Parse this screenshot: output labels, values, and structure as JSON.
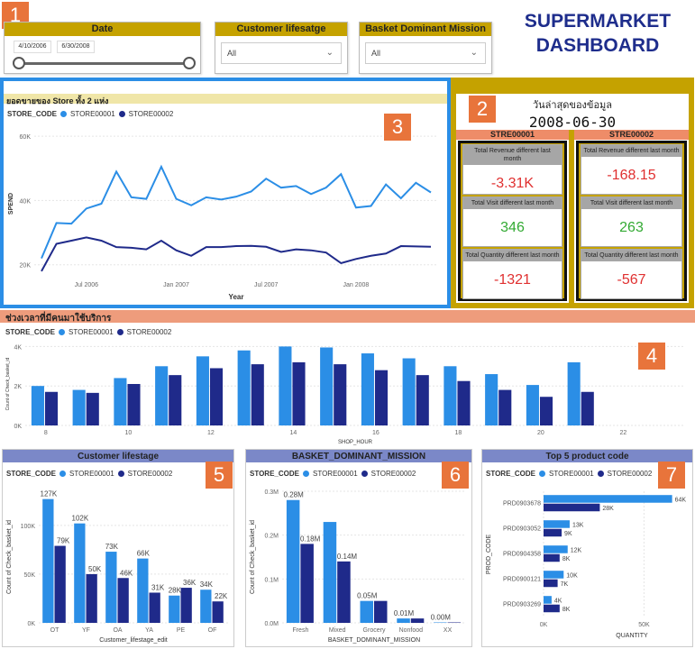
{
  "dashboard_title_line1": "SUPERMARKET",
  "dashboard_title_line2": "DASHBOARD",
  "badges": [
    "1",
    "2",
    "3",
    "4",
    "5",
    "6",
    "7"
  ],
  "colors": {
    "store1": "#2b8ee6",
    "store2": "#1f2a8a",
    "gold": "#c5a200",
    "blue_panel": "#2b8ee6",
    "orange": "#ee8c68",
    "red": "#e03030",
    "green": "#33aa33"
  },
  "date_slicer": {
    "title": "Date",
    "start": "4/10/2006",
    "end": "6/30/2008"
  },
  "lifestage_slicer": {
    "title": "Customer lifesatge",
    "value": "All"
  },
  "mission_slicer": {
    "title": "Basket Dominant Mission",
    "value": "All"
  },
  "latest_date": {
    "label": "วันล่าสุดของข้อมูล",
    "value": "2008-06-30"
  },
  "store_cards": [
    {
      "name": "STRE00001",
      "rev_label": "Total Revenue different last month",
      "rev": "-3.31K",
      "visit_label": "Total Visit different last month",
      "visit": "346",
      "qty_label": "Total Quantity different last month",
      "qty": "-1321"
    },
    {
      "name": "STRE00002",
      "rev_label": "Total Revenue different last month",
      "rev": "-168.15",
      "visit_label": "Total Visit different last month",
      "visit": "263",
      "qty_label": "Total Quantity different last month",
      "qty": "-567"
    }
  ],
  "legend": {
    "title": "STORE_CODE",
    "s1": "STORE00001",
    "s2": "STORE00002"
  },
  "chart_data": [
    {
      "type": "line",
      "title": "ยอดขายของ Store ทั้ง 2 แห่ง",
      "xlabel": "Year",
      "ylabel": "SPEND",
      "ylim": [
        16000,
        62000
      ],
      "yticks": [
        "20K",
        "40K",
        "60K"
      ],
      "xticks": [
        "Jul 2006",
        "Jan 2007",
        "Jul 2007",
        "Jan 2008"
      ],
      "series": [
        {
          "name": "STORE00001",
          "values": [
            22000,
            33000,
            32800,
            37500,
            39000,
            49000,
            41000,
            40500,
            50500,
            40500,
            38500,
            41000,
            40300,
            41200,
            42800,
            46800,
            44000,
            44500,
            42000,
            44000,
            48200,
            37800,
            38300,
            45000,
            40700,
            45500,
            42500
          ]
        },
        {
          "name": "STORE00002",
          "values": [
            18000,
            26500,
            27500,
            28500,
            27500,
            25500,
            25300,
            24800,
            27500,
            24500,
            22800,
            25500,
            25500,
            25800,
            25900,
            25600,
            24000,
            24800,
            24500,
            23800,
            20500,
            21800,
            22800,
            23500,
            25800,
            25700,
            25600
          ]
        }
      ]
    },
    {
      "type": "bar",
      "title": "ช่วงเวลาที่มีคนมาใช้บริการ",
      "xlabel": "SHOP_HOUR",
      "ylabel": "Count of Check_basket_id",
      "ylim": [
        0,
        4200
      ],
      "yticks": [
        "0K",
        "2K",
        "4K"
      ],
      "xticks": [
        "8",
        "10",
        "12",
        "14",
        "16",
        "18",
        "20",
        "22"
      ],
      "categories": [
        "8",
        "9",
        "10",
        "11",
        "12",
        "13",
        "14",
        "15",
        "16",
        "17",
        "18",
        "19",
        "20",
        "21"
      ],
      "series": [
        {
          "name": "STORE00001",
          "values": [
            2000,
            1800,
            2400,
            3000,
            3500,
            3800,
            4000,
            3950,
            3650,
            3400,
            3000,
            2600,
            2050,
            3200
          ]
        },
        {
          "name": "STORE00002",
          "values": [
            1700,
            1650,
            2100,
            2550,
            2900,
            3100,
            3200,
            3100,
            2800,
            2550,
            2250,
            1800,
            1450,
            1700
          ]
        }
      ]
    },
    {
      "type": "bar",
      "title": "Customer lifestage",
      "xlabel": "Customer_lifestage_edit",
      "ylabel": "Count of Check_basket_id",
      "ylim": [
        0,
        135000
      ],
      "yticks": [
        "0K",
        "50K",
        "100K"
      ],
      "categories": [
        "OT",
        "YF",
        "OA",
        "YA",
        "PE",
        "OF"
      ],
      "series": [
        {
          "name": "STORE00001",
          "values": [
            127000,
            102000,
            73000,
            66000,
            28000,
            34000
          ],
          "labels": [
            "127K",
            "102K",
            "73K",
            "66K",
            "28K",
            "34K"
          ]
        },
        {
          "name": "STORE00002",
          "values": [
            79000,
            50000,
            46000,
            31000,
            36000,
            22000
          ],
          "labels": [
            "79K",
            "50K",
            "46K",
            "31K",
            "36K",
            "22K"
          ]
        }
      ]
    },
    {
      "type": "bar",
      "title": "BASKET_DOMINANT_MISSION",
      "xlabel": "BASKET_DOMINANT_MISSION",
      "ylabel": "Count of Check_basket_id",
      "ylim": [
        0,
        0.3
      ],
      "yticks": [
        "0.0M",
        "0.1M",
        "0.2M",
        "0.3M"
      ],
      "categories": [
        "Fresh",
        "Mixed",
        "Grocery",
        "Nonfood",
        "XX"
      ],
      "series": [
        {
          "name": "STORE00001",
          "values": [
            0.28,
            0.23,
            0.05,
            0.01,
            0.0
          ],
          "labels": [
            "0.28M",
            "",
            "0.05M",
            "0.01M",
            "0.00M"
          ]
        },
        {
          "name": "STORE00002",
          "values": [
            0.18,
            0.14,
            0.05,
            0.01,
            0.0
          ],
          "labels": [
            "0.18M",
            "0.14M",
            "",
            "",
            ""
          ]
        }
      ]
    },
    {
      "type": "bar",
      "orientation": "horizontal",
      "title": "Top 5 product code",
      "xlabel": "QUANTITY",
      "ylabel": "PROD_CODE",
      "xlim": [
        0,
        70000
      ],
      "xticks": [
        "0K",
        "50K"
      ],
      "categories": [
        "PRD0903678",
        "PRD0903052",
        "PRD0904358",
        "PRD0900121",
        "PRD0903269"
      ],
      "series": [
        {
          "name": "STORE00001",
          "values": [
            64000,
            13000,
            12000,
            10000,
            4000
          ],
          "labels": [
            "64K",
            "13K",
            "12K",
            "10K",
            "4K"
          ]
        },
        {
          "name": "STORE00002",
          "values": [
            28000,
            9000,
            8000,
            7000,
            8000
          ],
          "labels": [
            "28K",
            "9K",
            "8K",
            "7K",
            "8K"
          ]
        }
      ]
    }
  ]
}
